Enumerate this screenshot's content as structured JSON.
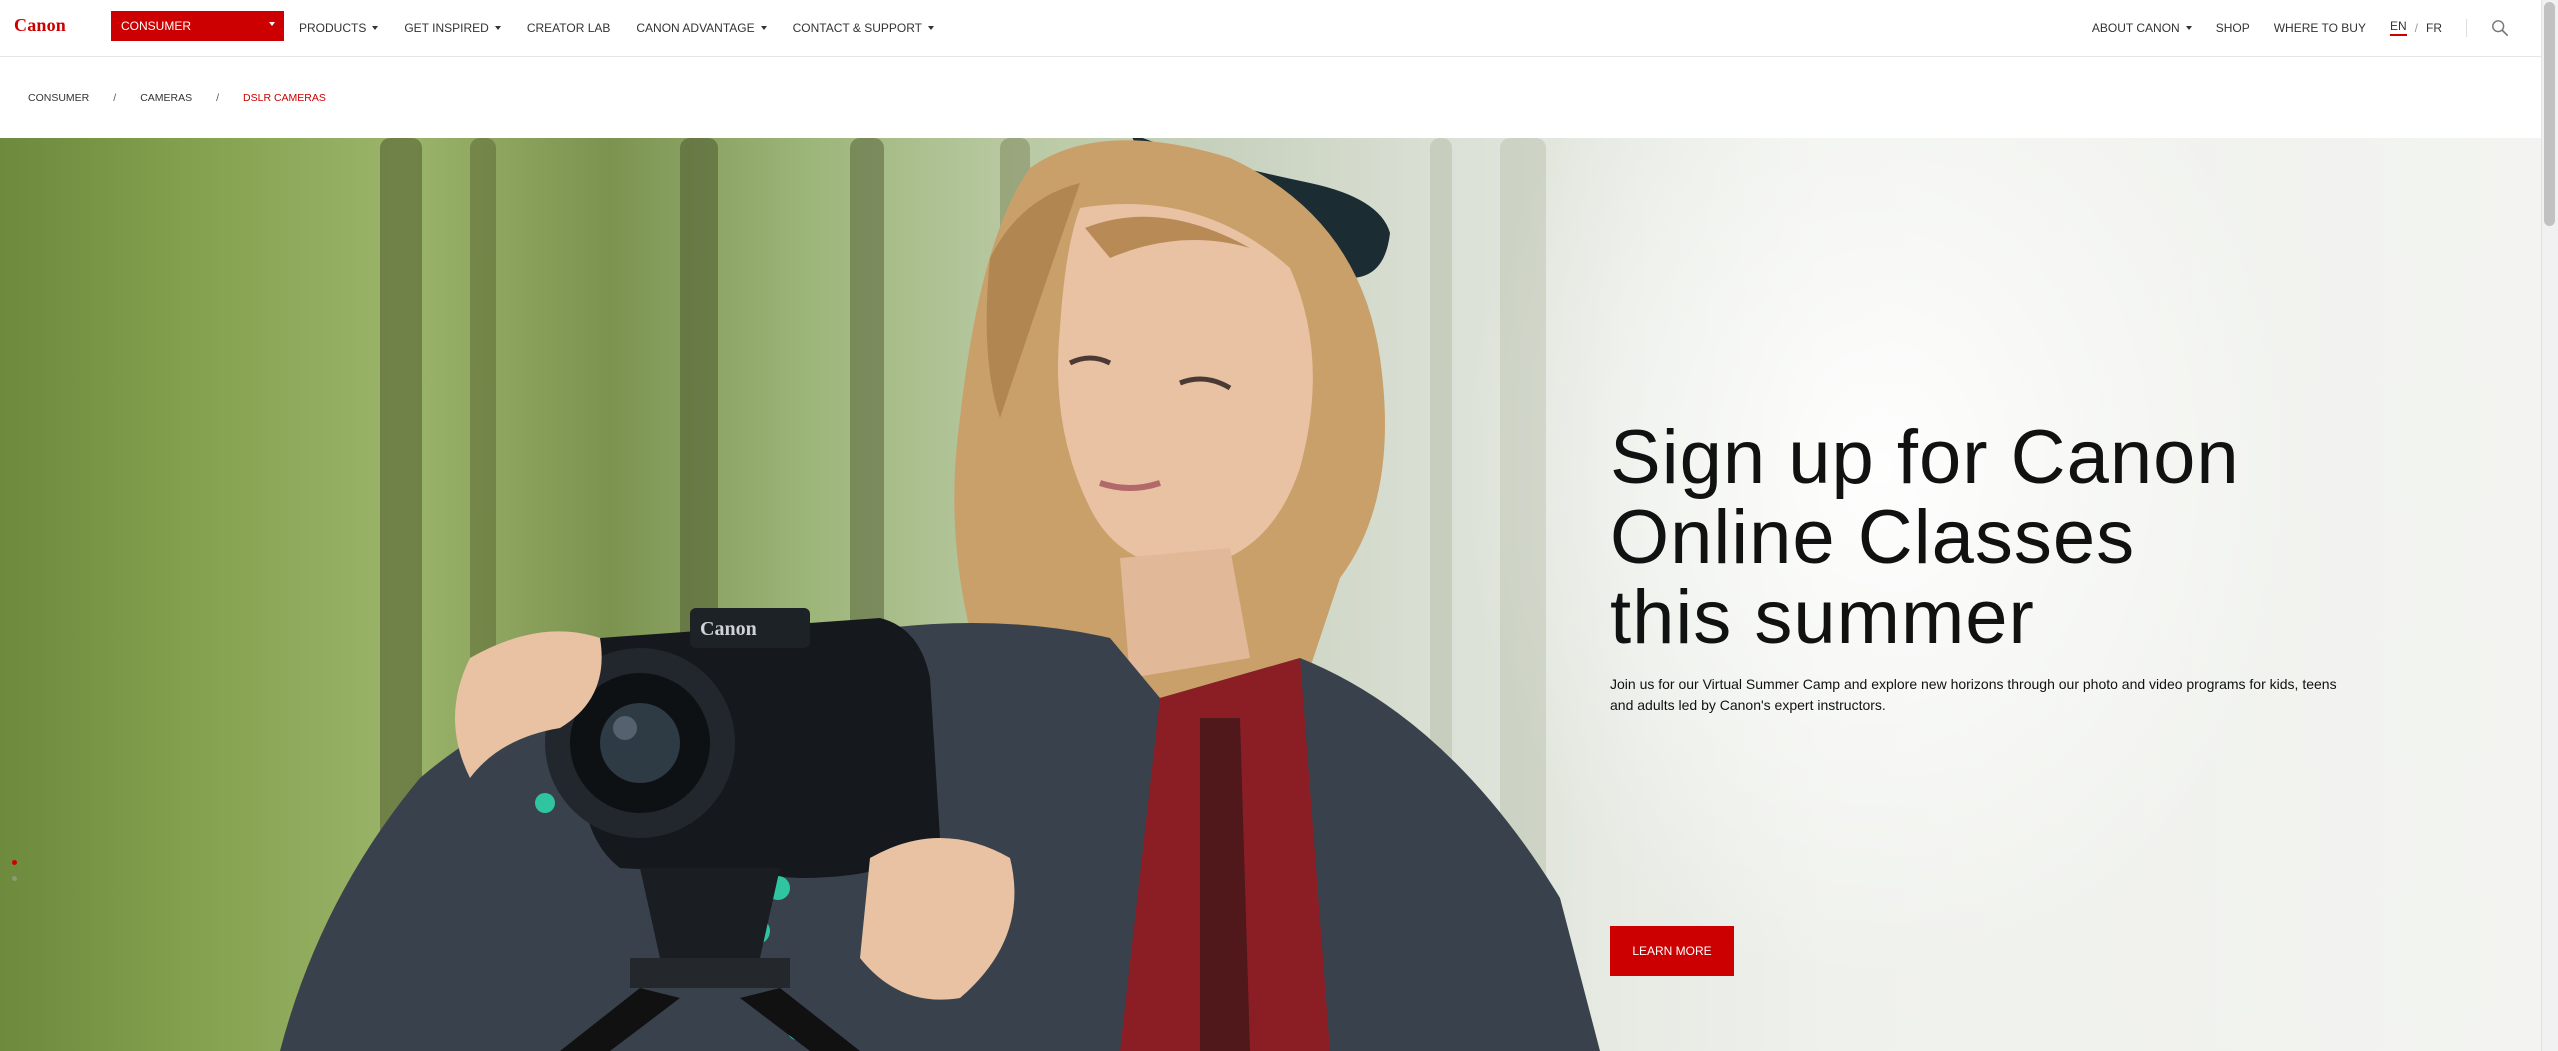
{
  "header": {
    "logo": "Canon",
    "segment_label": "CONSUMER",
    "nav_left": [
      {
        "label": "PRODUCTS",
        "dropdown": true
      },
      {
        "label": "GET INSPIRED",
        "dropdown": true
      },
      {
        "label": "CREATOR LAB",
        "dropdown": false
      },
      {
        "label": "CANON ADVANTAGE",
        "dropdown": true
      },
      {
        "label": "CONTACT & SUPPORT",
        "dropdown": true
      }
    ],
    "nav_right": [
      {
        "label": "ABOUT CANON",
        "dropdown": true
      },
      {
        "label": "SHOP",
        "dropdown": false
      },
      {
        "label": "WHERE TO BUY",
        "dropdown": false
      }
    ],
    "lang": {
      "active": "EN",
      "separator": "/",
      "other": "FR"
    },
    "search_icon": "search-icon"
  },
  "breadcrumb": {
    "items": [
      "CONSUMER",
      "CAMERAS",
      "DSLR CAMERAS"
    ],
    "separator": "/"
  },
  "hero": {
    "title_line1": "Sign up for Canon",
    "title_line2": "Online Classes",
    "title_line3": "this summer",
    "description": "Join us for our Virtual Summer Camp and explore new horizons through our photo and video programs for kids, teens and adults led by Canon's expert instructors.",
    "cta_label": "LEARN MORE"
  },
  "colors": {
    "brand_red": "#cc0000",
    "text_dark": "#111111"
  }
}
